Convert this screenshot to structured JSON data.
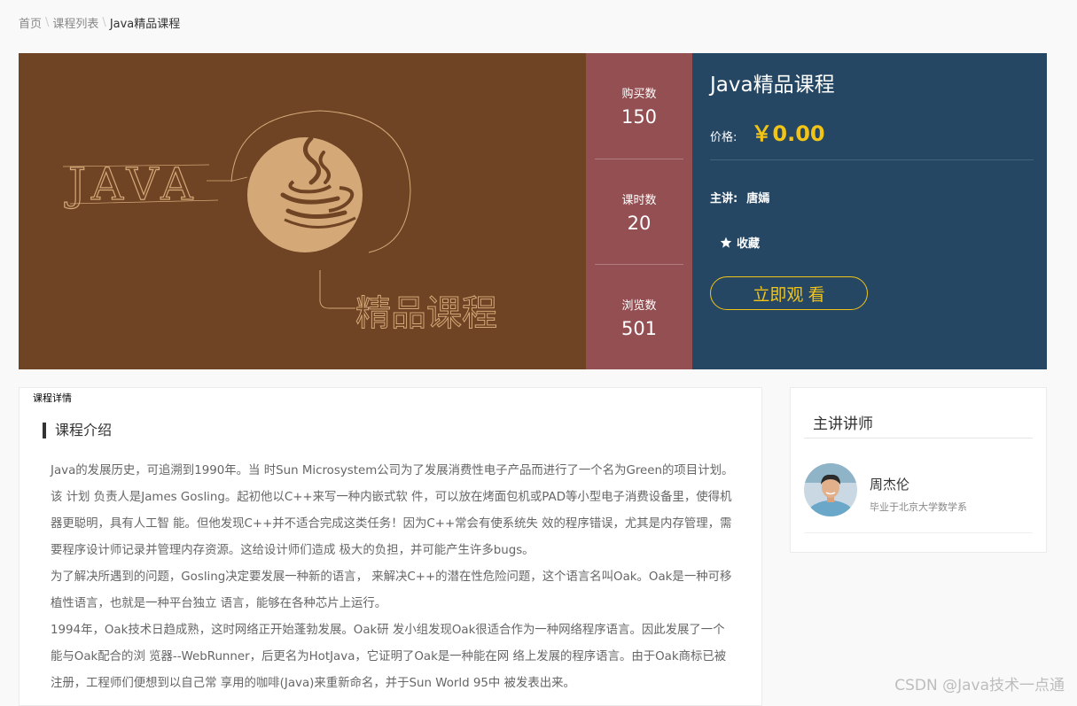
{
  "breadcrumb": {
    "items": [
      "首页",
      "课程列表"
    ],
    "separator": "\\",
    "current": "Java精品课程"
  },
  "cover": {
    "logo_text": "JAVA",
    "subtitle": "精品课程",
    "bg_color": "#6e4424",
    "accent_color": "#d4a877",
    "icon": "coffee-cup-icon"
  },
  "stats": [
    {
      "label": "购买数",
      "value": "150"
    },
    {
      "label": "课时数",
      "value": "20"
    },
    {
      "label": "浏览数",
      "value": "501"
    }
  ],
  "course": {
    "title": "Java精品课程",
    "price_label": "价格:",
    "price": "￥0.00",
    "teacher_label": "主讲:",
    "teacher": "唐嫣",
    "favorite_label": "收藏",
    "watch_button": "立即观 看"
  },
  "detail": {
    "tab_label": "课程详情",
    "section_title": "课程介绍",
    "paragraphs": [
      "Java的发展历史，可追溯到1990年。当 时Sun Microsystem公司为了发展消费性电子产品而进行了一个名为Green的项目计划。该 计划 负责人是James Gosling。起初他以C++来写一种内嵌式软 件，可以放在烤面包机或PAD等小型电子消费设备里，使得机器更聪明，具有人工智 能。但他发现C++并不适合完成这类任务！因为C++常会有使系统失 效的程序错误，尤其是内存管理，需要程序设计师记录并管理内存资源。这给设计师们造成 极大的负担，并可能产生许多bugs。",
      "为了解决所遇到的问题，Gosling决定要发展一种新的语言， 来解决C++的潜在性危险问题，这个语言名叫Oak。Oak是一种可移植性语言，也就是一种平台独立 语言，能够在各种芯片上运行。",
      "1994年，Oak技术日趋成熟，这时网络正开始蓬勃发展。Oak研 发小组发现Oak很适合作为一种网络程序语言。因此发展了一个能与Oak配合的浏 览器--WebRunner，后更名为HotJava，它证明了Oak是一种能在网 络上发展的程序语言。由于Oak商标已被注册，工程师们便想到以自己常 享用的咖啡(Java)来重新命名，并于Sun World 95中 被发表出来。"
    ]
  },
  "instructor": {
    "card_title": "主讲讲师",
    "name": "周杰伦",
    "description": "毕业于北京大学数学系"
  },
  "watermark": "CSDN @Java技术一点通",
  "colors": {
    "stats_bg": "#944f53",
    "info_bg": "#254764",
    "price": "#f2c417"
  }
}
